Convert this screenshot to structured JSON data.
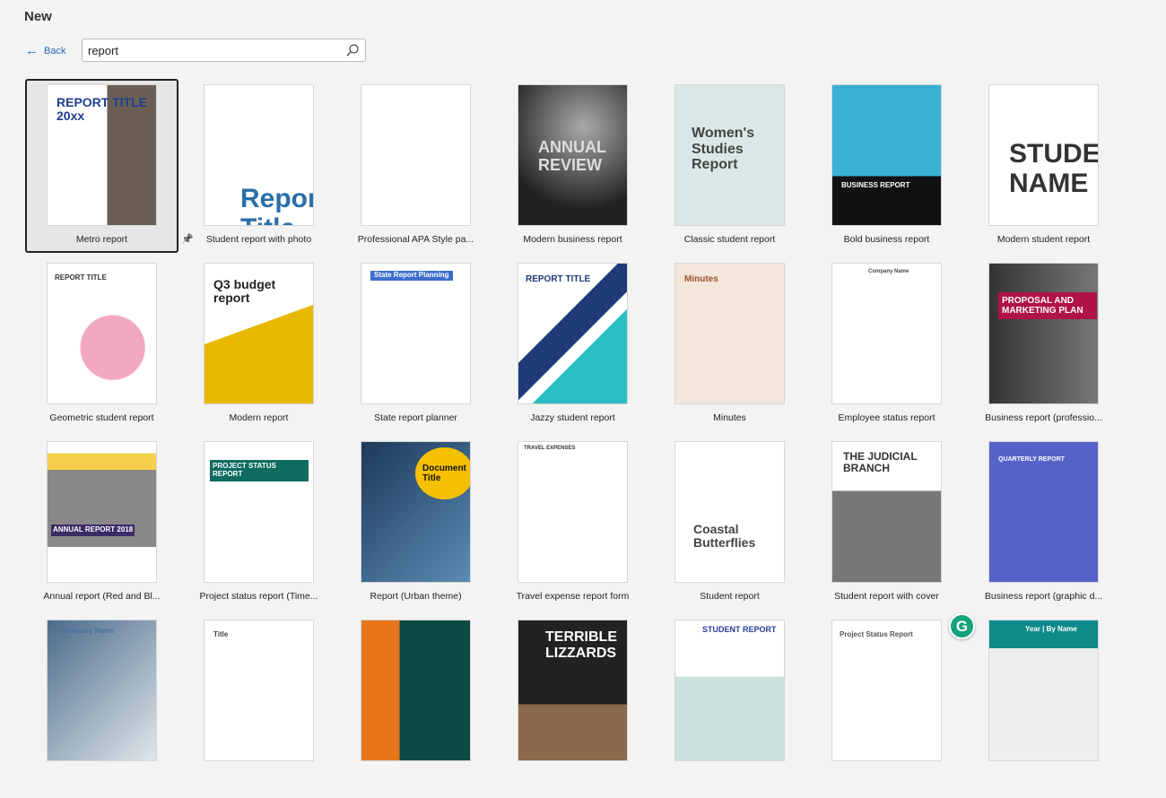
{
  "header": {
    "title": "New",
    "back_label": "Back",
    "back_icon": "arrow-left-icon"
  },
  "search": {
    "value": "report",
    "icon": "search-icon"
  },
  "selected_index": 0,
  "templates": [
    {
      "label": "Metro report",
      "thumb_text": "REPORT TITLE 20xx"
    },
    {
      "label": "Student report with photo",
      "thumb_text": "Report Title"
    },
    {
      "label": "Professional APA Style pa...",
      "thumb_text": ""
    },
    {
      "label": "Modern business report",
      "thumb_text": "ANNUAL REVIEW"
    },
    {
      "label": "Classic student report",
      "thumb_text": "Women's Studies Report"
    },
    {
      "label": "Bold business report",
      "thumb_text": "BUSINESS REPORT"
    },
    {
      "label": "Modern student report",
      "thumb_text": "STUDENT'S NAME"
    },
    {
      "label": "Geometric student report",
      "thumb_text": "REPORT TITLE"
    },
    {
      "label": "Modern report",
      "thumb_text": "Q3 budget report"
    },
    {
      "label": "State report planner",
      "thumb_text": "State Report Planning"
    },
    {
      "label": "Jazzy student report",
      "thumb_text": "REPORT TITLE"
    },
    {
      "label": "Minutes",
      "thumb_text": "Minutes"
    },
    {
      "label": "Employee status report",
      "thumb_text": "Company Name"
    },
    {
      "label": "Business report (professio...",
      "thumb_text": "PROPOSAL AND MARKETING PLAN"
    },
    {
      "label": "Annual report (Red and Bl...",
      "thumb_text": "ANNUAL REPORT 2018"
    },
    {
      "label": "Project status report (Time...",
      "thumb_text": "PROJECT STATUS REPORT"
    },
    {
      "label": "Report (Urban theme)",
      "thumb_text": "Document Title"
    },
    {
      "label": "Travel expense report form",
      "thumb_text": "TRAVEL EXPENSES"
    },
    {
      "label": "Student report",
      "thumb_text": "Coastal Butterflies"
    },
    {
      "label": "Student report with cover",
      "thumb_text": "THE JUDICIAL BRANCH"
    },
    {
      "label": "Business report (graphic d...",
      "thumb_text": "QUARTERLY REPORT"
    },
    {
      "label": "",
      "thumb_text": "Company Name"
    },
    {
      "label": "",
      "thumb_text": "Title"
    },
    {
      "label": "",
      "thumb_text": ""
    },
    {
      "label": "",
      "thumb_text": "TERRIBLE LIZZARDS"
    },
    {
      "label": "",
      "thumb_text": "STUDENT REPORT"
    },
    {
      "label": "",
      "thumb_text": "Project Status Report"
    },
    {
      "label": "",
      "thumb_text": "Year | By Name"
    }
  ],
  "extension_badge": {
    "text": "G",
    "color": "#15a37b"
  },
  "colors": {
    "accent": "#2b63c0",
    "background": "#f3f3f3"
  }
}
